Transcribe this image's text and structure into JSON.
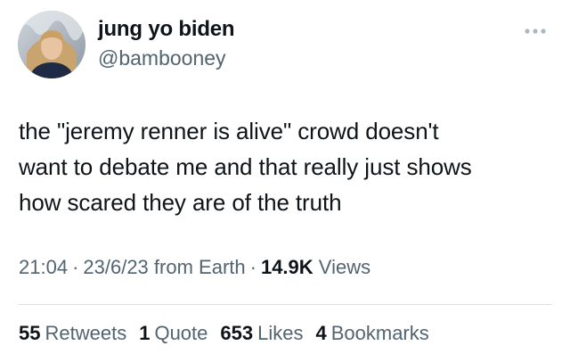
{
  "author": {
    "display_name": "jung yo biden",
    "handle": "@bambooney",
    "avatar_icon": "profile-photo"
  },
  "menu": {
    "icon": "more-horizontal-icon"
  },
  "tweet": {
    "lines": [
      "the \"jeremy renner is alive\" crowd doesn't",
      "want to debate me and that really just shows",
      "how scared they are of the truth"
    ]
  },
  "meta": {
    "time": "21:04",
    "separator": "·",
    "date": "23/6/23",
    "source": "from Earth",
    "views_count": "14.9K",
    "views_label": "Views"
  },
  "stats": {
    "retweets_count": "55",
    "retweets_label": "Retweets",
    "quotes_count": "1",
    "quotes_label": "Quote",
    "likes_count": "653",
    "likes_label": "Likes",
    "bookmarks_count": "4",
    "bookmarks_label": "Bookmarks"
  },
  "colors": {
    "text_primary": "#0f1419",
    "text_secondary": "#536471",
    "divider": "#d9dee3"
  }
}
